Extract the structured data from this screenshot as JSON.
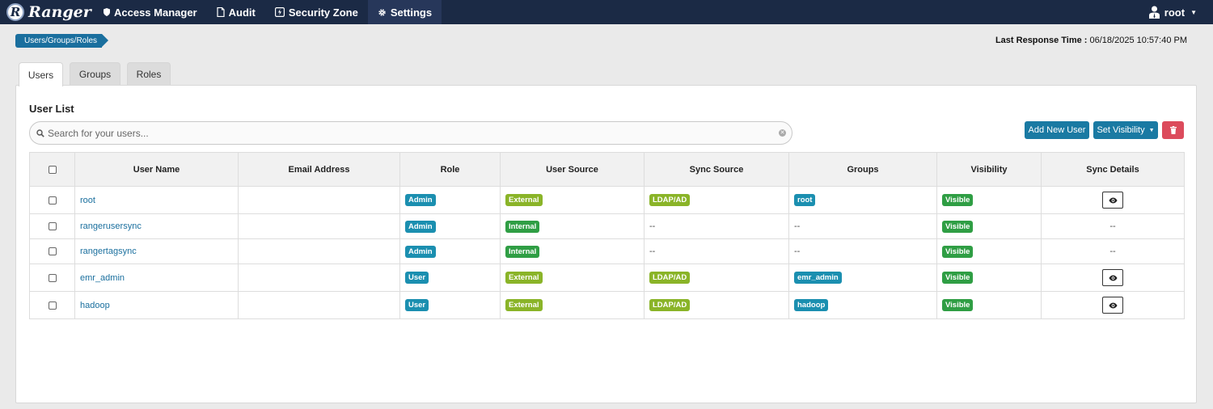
{
  "app": {
    "name": "Ranger",
    "logo_letter": "R"
  },
  "nav": {
    "items": [
      {
        "label": "Access Manager",
        "icon": "shield-icon"
      },
      {
        "label": "Audit",
        "icon": "file-icon"
      },
      {
        "label": "Security Zone",
        "icon": "zone-icon"
      },
      {
        "label": "Settings",
        "icon": "gear-icon"
      }
    ],
    "user": "root"
  },
  "breadcrumb": "Users/Groups/Roles",
  "response_time": {
    "label": "Last Response Time :",
    "value": "06/18/2025 10:57:40 PM"
  },
  "tabs": [
    {
      "label": "Users",
      "active": true
    },
    {
      "label": "Groups",
      "active": false
    },
    {
      "label": "Roles",
      "active": false
    }
  ],
  "panel": {
    "title": "User List",
    "search_placeholder": "Search for your users...",
    "add_button": "Add New User",
    "visibility_button": "Set Visibility"
  },
  "table": {
    "headers": [
      "User Name",
      "Email Address",
      "Role",
      "User Source",
      "Sync Source",
      "Groups",
      "Visibility",
      "Sync Details"
    ],
    "rows": [
      {
        "name": "root",
        "email": "",
        "role": "Admin",
        "source": "External",
        "sync_source": "LDAP/AD",
        "groups": "root",
        "visibility": "Visible",
        "sync_details": "eye"
      },
      {
        "name": "rangerusersync",
        "email": "",
        "role": "Admin",
        "source": "Internal",
        "sync_source": "--",
        "groups": "--",
        "visibility": "Visible",
        "sync_details": "--"
      },
      {
        "name": "rangertagsync",
        "email": "",
        "role": "Admin",
        "source": "Internal",
        "sync_source": "--",
        "groups": "--",
        "visibility": "Visible",
        "sync_details": "--"
      },
      {
        "name": "emr_admin",
        "email": "",
        "role": "User",
        "source": "External",
        "sync_source": "LDAP/AD",
        "groups": "emr_admin",
        "visibility": "Visible",
        "sync_details": "eye"
      },
      {
        "name": "hadoop",
        "email": "",
        "role": "User",
        "source": "External",
        "sync_source": "LDAP/AD",
        "groups": "hadoop",
        "visibility": "Visible",
        "sync_details": "eye"
      }
    ]
  },
  "colors": {
    "navbar": "#1b2a45",
    "primary": "#1a7aa3",
    "danger": "#dc4b5c",
    "badge_blue": "#1b8fb0",
    "badge_green": "#2f9e44",
    "badge_olive": "#8ab428"
  }
}
